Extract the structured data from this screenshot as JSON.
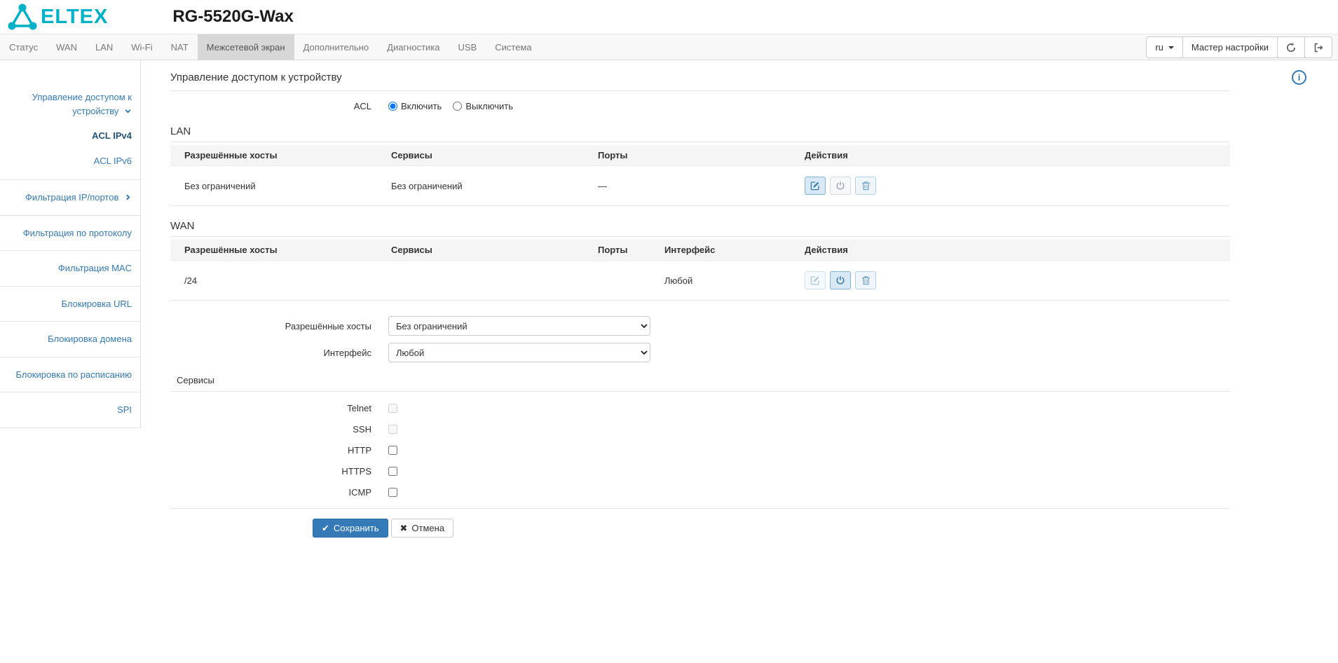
{
  "header": {
    "logo_text": "ELTEX",
    "device_title": "RG-5520G-Wax"
  },
  "nav": {
    "tabs": [
      {
        "label": "Статус",
        "active": false
      },
      {
        "label": "WAN",
        "active": false
      },
      {
        "label": "LAN",
        "active": false
      },
      {
        "label": "Wi-Fi",
        "active": false
      },
      {
        "label": "NAT",
        "active": false
      },
      {
        "label": "Межсетевой экран",
        "active": true
      },
      {
        "label": "Дополнительно",
        "active": false
      },
      {
        "label": "Диагностика",
        "active": false
      },
      {
        "label": "USB",
        "active": false
      },
      {
        "label": "Система",
        "active": false
      }
    ],
    "language": "ru",
    "wizard_label": "Мастер настройки"
  },
  "sidebar": {
    "items": [
      {
        "label": "Управление доступом к устройству",
        "expanded": true
      },
      {
        "label": "ACL IPv4",
        "active": true
      },
      {
        "label": "ACL IPv6",
        "active": false
      },
      {
        "label": "Фильтрация IP/портов",
        "collapsed": true
      },
      {
        "label": "Фильтрация по протоколу"
      },
      {
        "label": "Фильтрация MAC"
      },
      {
        "label": "Блокировка URL"
      },
      {
        "label": "Блокировка домена"
      },
      {
        "label": "Блокировка по расписанию"
      },
      {
        "label": "SPI"
      }
    ]
  },
  "main": {
    "page_title": "Управление доступом к устройству",
    "acl": {
      "label": "ACL",
      "options": [
        {
          "label": "Включить",
          "selected": true
        },
        {
          "label": "Выключить",
          "selected": false
        }
      ]
    },
    "lan": {
      "section_title": "LAN",
      "headers": [
        "Разрешённые хосты",
        "Сервисы",
        "Порты",
        "Действия"
      ],
      "rows": [
        {
          "hosts": "Без ограничений",
          "services": "Без ограничений",
          "ports": "—"
        }
      ]
    },
    "wan": {
      "section_title": "WAN",
      "headers": [
        "Разрешённые хосты",
        "Сервисы",
        "Порты",
        "Интерфейс",
        "Действия"
      ],
      "rows": [
        {
          "hosts": "/24",
          "services": "",
          "ports": "",
          "interface": "Любой"
        }
      ]
    },
    "form": {
      "hosts_label": "Разрешённые хосты",
      "hosts_value": "Без ограничений",
      "interface_label": "Интерфейс",
      "interface_value": "Любой",
      "services_label": "Сервисы",
      "services": [
        {
          "label": "Telnet",
          "disabled": true,
          "checked": false
        },
        {
          "label": "SSH",
          "disabled": true,
          "checked": false
        },
        {
          "label": "HTTP",
          "disabled": false,
          "checked": false
        },
        {
          "label": "HTTPS",
          "disabled": false,
          "checked": false
        },
        {
          "label": "ICMP",
          "disabled": false,
          "checked": false
        }
      ]
    },
    "footer": {
      "save_label": "Сохранить",
      "cancel_label": "Отмена"
    }
  },
  "icons": {
    "save_check": "✔",
    "cancel_x": "✖",
    "info": "i"
  },
  "colors": {
    "brand_teal": "#00b2c8",
    "link_blue": "#337ab7",
    "primary_button": "#337ab7",
    "active_tab_bg": "#d7d7d7"
  }
}
